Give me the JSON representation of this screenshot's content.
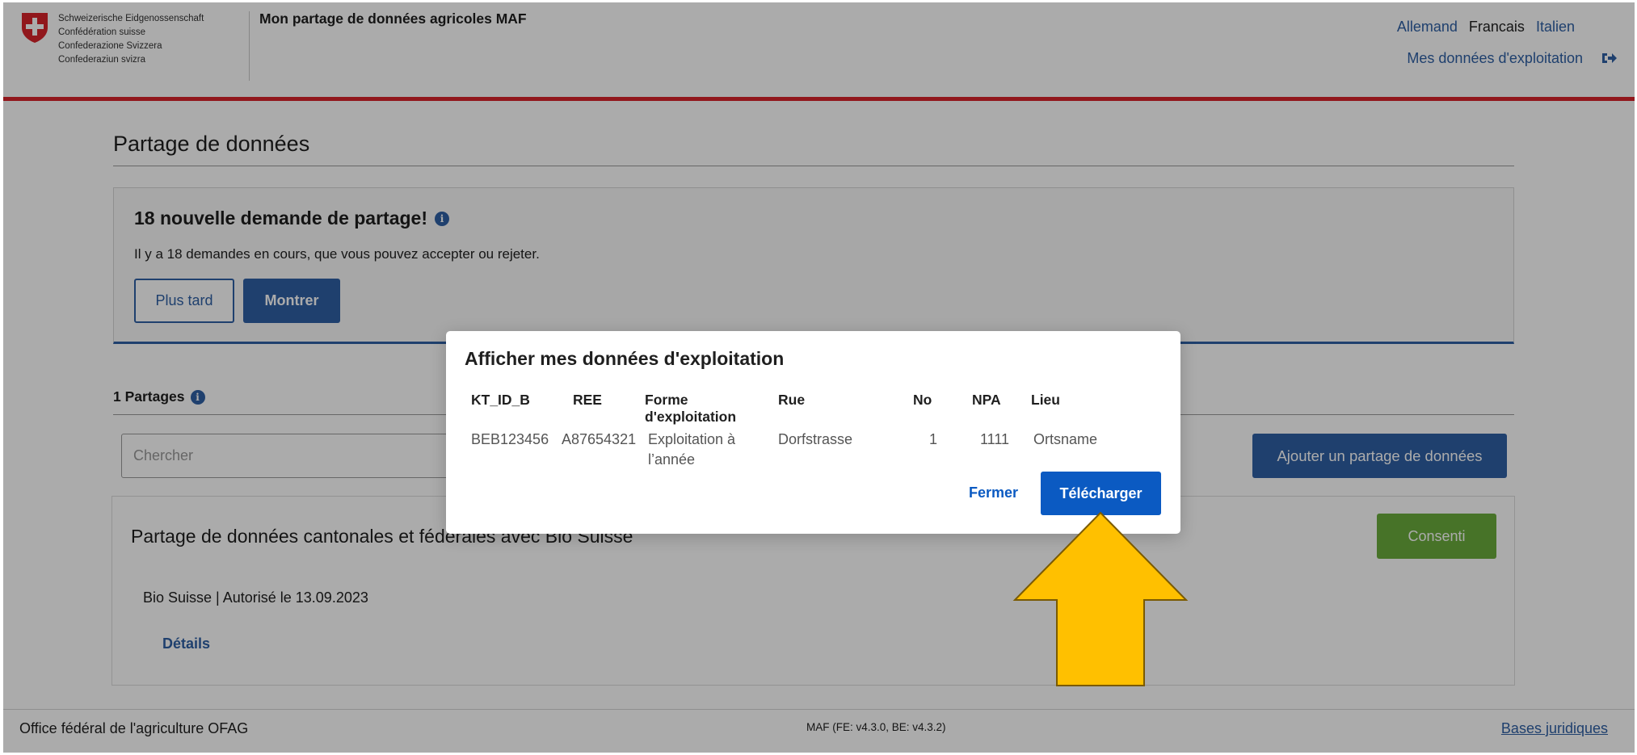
{
  "header": {
    "confederation": [
      "Schweizerische Eidgenossenschaft",
      "Confédération suisse",
      "Confederazione Svizzera",
      "Confederaziun svizra"
    ],
    "app_title": "Mon partage de données agricoles MAF",
    "languages": [
      "Allemand",
      "Francais",
      "Italien"
    ],
    "active_language": "Francais",
    "account_link": "Mes données d'exploitation"
  },
  "main": {
    "section_title": "Partage de données",
    "notice": {
      "title": "18 nouvelle demande de partage!",
      "text": "Il y a 18 demandes en cours, que vous pouvez accepter ou rejeter.",
      "later_label": "Plus tard",
      "show_label": "Montrer"
    },
    "shares_title": "1 Partages",
    "search_placeholder": "Chercher",
    "add_label": "Ajouter un partage de données",
    "card": {
      "title": "Partage de données cantonales et fédérales avec Bio Suisse",
      "consent_label": "Consenti",
      "subtitle": "Bio Suisse | Autorisé le 13.09.2023",
      "details_label": "Détails"
    }
  },
  "footer": {
    "left": "Office fédéral de l'agriculture OFAG",
    "version": "MAF (FE: v4.3.0, BE: v4.3.2)",
    "legal_link": "Bases juridiques"
  },
  "modal": {
    "title": "Afficher mes données d'exploitation",
    "columns": [
      "KT_ID_B",
      "REE",
      "Forme d'exploitation",
      "Rue",
      "No",
      "NPA",
      "Lieu"
    ],
    "row": [
      "BEB123456",
      "A87654321",
      "Exploitation à l’année",
      "Dorfstrasse",
      "1",
      "1111",
      "Ortsname"
    ],
    "close_label": "Fermer",
    "download_label": "Télécharger"
  },
  "colors": {
    "brand_red": "#d8232a",
    "primary_blue": "#2f60a5",
    "modal_blue": "#0b5ac2",
    "consent_green": "#6aac3c",
    "arrow_yellow": "#ffc000"
  },
  "icons": [
    "swiss-coat-of-arms-icon",
    "info-icon",
    "logout-icon",
    "up-arrow-icon"
  ]
}
